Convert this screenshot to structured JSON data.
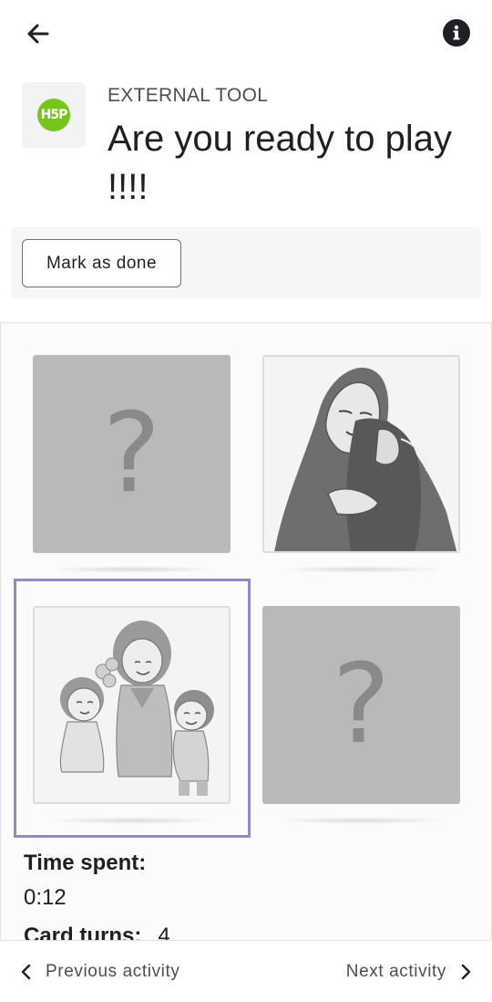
{
  "topbar": {
    "back_icon": "arrow-left-icon",
    "info_icon": "info-icon"
  },
  "header": {
    "tool_icon": "h5p-logo",
    "tool_logo_text": "H5P",
    "tool_type": "EXTERNAL TOOL",
    "title": "Are you ready to play !!!!"
  },
  "completion": {
    "mark_done_label": "Mark as done"
  },
  "game": {
    "cards": [
      {
        "state": "hidden",
        "symbol": "?"
      },
      {
        "state": "revealed",
        "image": "woman-hugging-illustration"
      },
      {
        "state": "revealed",
        "image": "mother-with-children-illustration",
        "focused": true
      },
      {
        "state": "hidden",
        "symbol": "?"
      }
    ],
    "time_spent_label": "Time spent:",
    "time_spent_value": "0:12",
    "card_turns_label": "Card turns:",
    "card_turns_value": "4"
  },
  "footer": {
    "prev_label": "Previous activity",
    "next_label": "Next activity",
    "prev_icon": "chevron-left-icon",
    "next_icon": "chevron-right-icon"
  },
  "colors": {
    "text": "#1d2125",
    "muted": "#4a4f55",
    "h5p_green": "#77c41b",
    "focus": "#8f8cc2",
    "card_back": "#b9b9b9"
  }
}
